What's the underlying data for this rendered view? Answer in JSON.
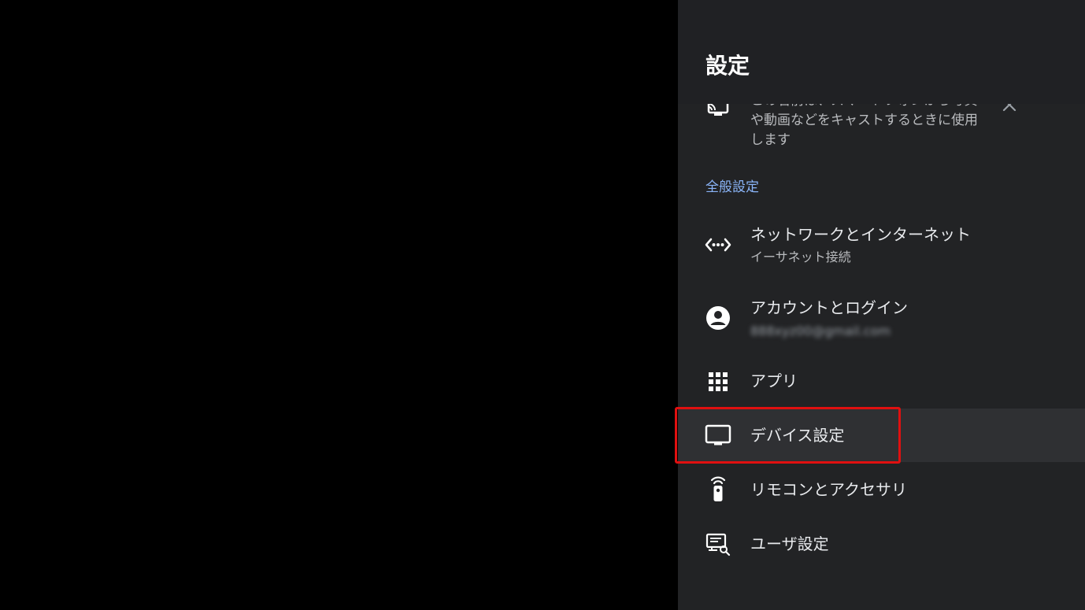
{
  "panel": {
    "title": "設定"
  },
  "cast_card": {
    "text": "この名前は、スマートフォンから写真や動画などをキャストするときに使用します",
    "icon": "cast-icon",
    "close_icon": "close-icon"
  },
  "section": {
    "general_label": "全般設定"
  },
  "menu": {
    "items": [
      {
        "label": "ネットワークとインターネット",
        "sub": "イーサネット接続",
        "icon": "network-icon"
      },
      {
        "label": "アカウントとログイン",
        "sub": "888xyz00@gmail.com",
        "icon": "account-icon"
      },
      {
        "label": "アプリ",
        "sub": "",
        "icon": "apps-grid-icon"
      },
      {
        "label": "デバイス設定",
        "sub": "",
        "icon": "tv-icon"
      },
      {
        "label": "リモコンとアクセサリ",
        "sub": "",
        "icon": "remote-icon"
      },
      {
        "label": "ユーザ設定",
        "sub": "",
        "icon": "user-settings-icon"
      }
    ],
    "selected_index": 3
  },
  "colors": {
    "panel_bg": "#222325",
    "header_bg": "#202124",
    "accent_blue": "#8ab4f8",
    "highlight_red": "#e01010",
    "active_row": "#2f3033"
  }
}
